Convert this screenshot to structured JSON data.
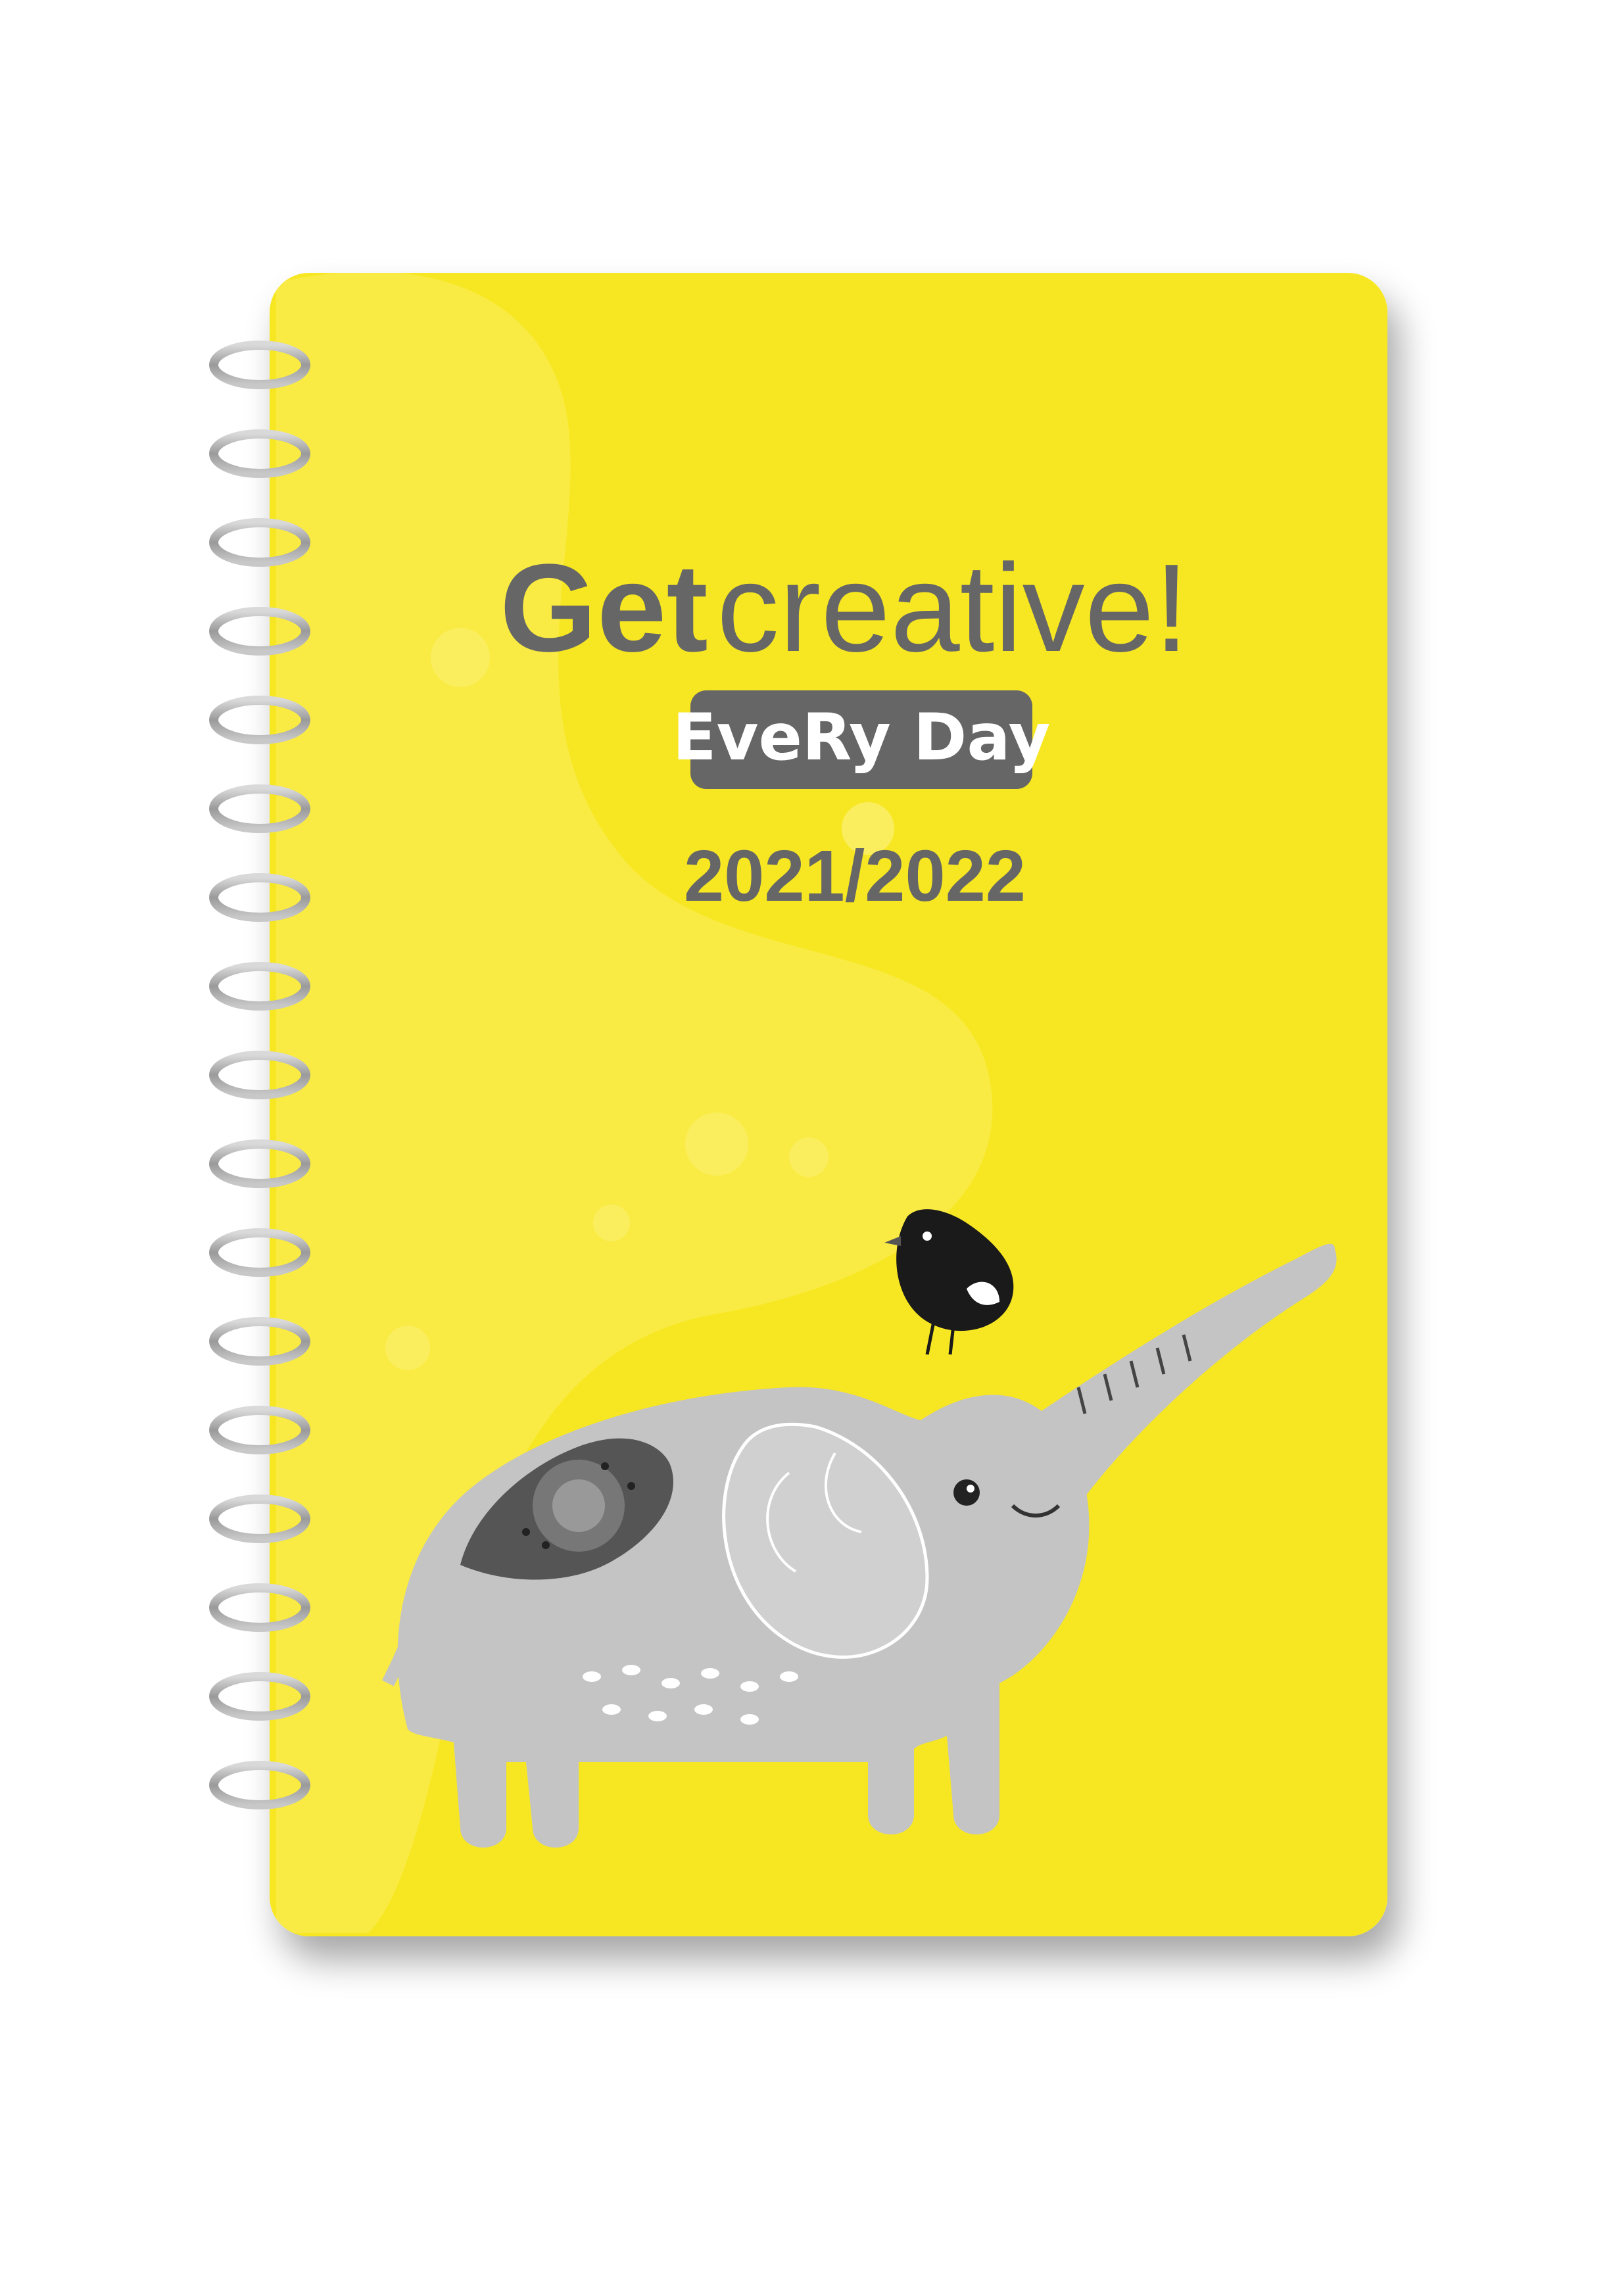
{
  "cover": {
    "color": "#f7e724",
    "title_bold": "Get",
    "title_rest": "creative!",
    "tagline": "EveRy Day",
    "year": "2021/2022",
    "text_color": "#666666"
  },
  "illustration": {
    "main": "elephant",
    "accent": "bird"
  }
}
